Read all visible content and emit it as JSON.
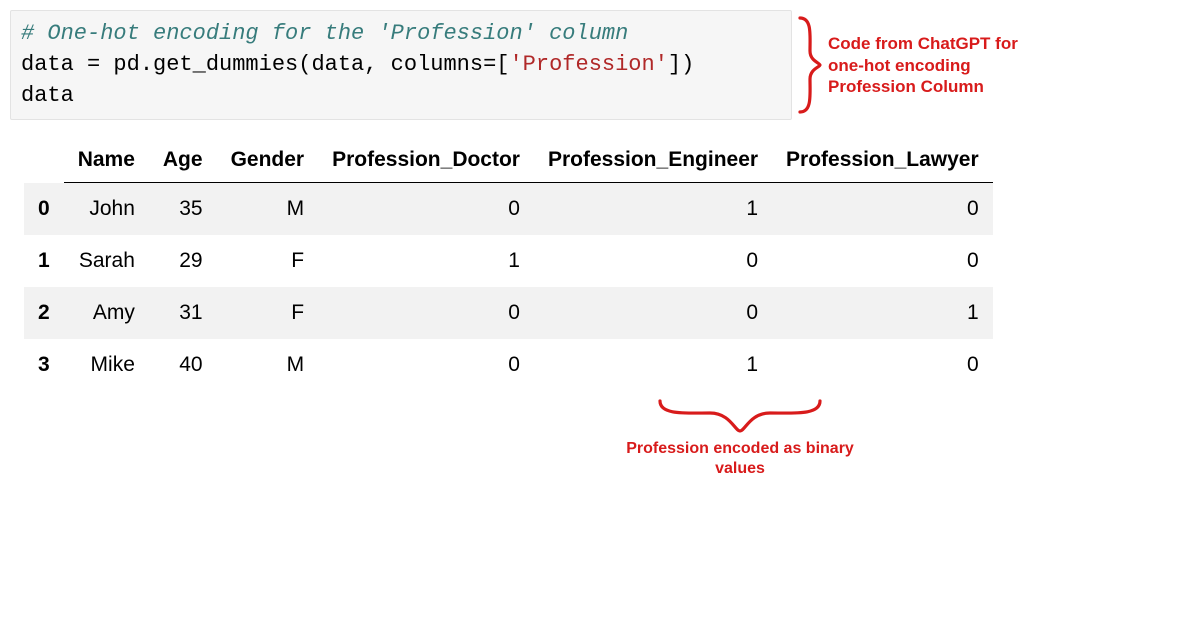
{
  "code": {
    "comment": "# One-hot encoding for the 'Profession' column",
    "line2_pre": "data = pd.get_dummies(data, columns=[",
    "line2_str": "'Profession'",
    "line2_post": "])",
    "line3": "data"
  },
  "annotation_right": "Code from ChatGPT for one-hot encoding Profession Column",
  "annotation_bottom": "Profession encoded as binary values",
  "table": {
    "columns": [
      "",
      "Name",
      "Age",
      "Gender",
      "Profession_Doctor",
      "Profession_Engineer",
      "Profession_Lawyer"
    ],
    "rows": [
      {
        "idx": "0",
        "name": "John",
        "age": "35",
        "gender": "M",
        "pd": "0",
        "pe": "1",
        "pl": "0"
      },
      {
        "idx": "1",
        "name": "Sarah",
        "age": "29",
        "gender": "F",
        "pd": "1",
        "pe": "0",
        "pl": "0"
      },
      {
        "idx": "2",
        "name": "Amy",
        "age": "31",
        "gender": "F",
        "pd": "0",
        "pe": "0",
        "pl": "1"
      },
      {
        "idx": "3",
        "name": "Mike",
        "age": "40",
        "gender": "M",
        "pd": "0",
        "pe": "1",
        "pl": "0"
      }
    ]
  }
}
